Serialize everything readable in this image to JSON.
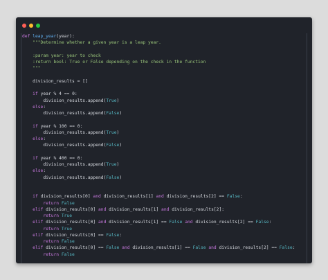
{
  "window": {
    "buttons": [
      "close",
      "minimize",
      "maximize"
    ]
  },
  "code": {
    "language": "python",
    "lines": [
      "def leap_year(year):",
      "    \"\"\"Determine whether a given year is a leap year.",
      "",
      "    :param year: year to check",
      "    :return bool: True or False depending on the check in the function",
      "    \"\"\"",
      "",
      "    division_results = []",
      "",
      "    if year % 4 == 0:",
      "        division_results.append(True)",
      "    else:",
      "        division_results.append(False)",
      "",
      "    if year % 100 == 0:",
      "        division_results.append(True)",
      "    else:",
      "        division_results.append(False)",
      "",
      "    if year % 400 == 0:",
      "        division_results.append(True)",
      "    else:",
      "        division_results.append(False)",
      "",
      "",
      "    if division_results[0] and division_results[1] and division_results[2] == False:",
      "        return False",
      "    elif division_results[0] and division_results[1] and division_results[2]:",
      "        return True",
      "    elif division_results[0] and division_results[1] == False and division_results[2] == False:",
      "        return True",
      "    elif division_results[0] == False:",
      "        return False",
      "    elif division_results[0] == False and division_results[1] == False and division_results[2] == False:",
      "        return False"
    ]
  },
  "colors": {
    "keyword": "#c678dd",
    "function": "#61afef",
    "string": "#98c379",
    "constant": "#56b6c2",
    "text": "#d7dae0",
    "background": "#20232a"
  }
}
